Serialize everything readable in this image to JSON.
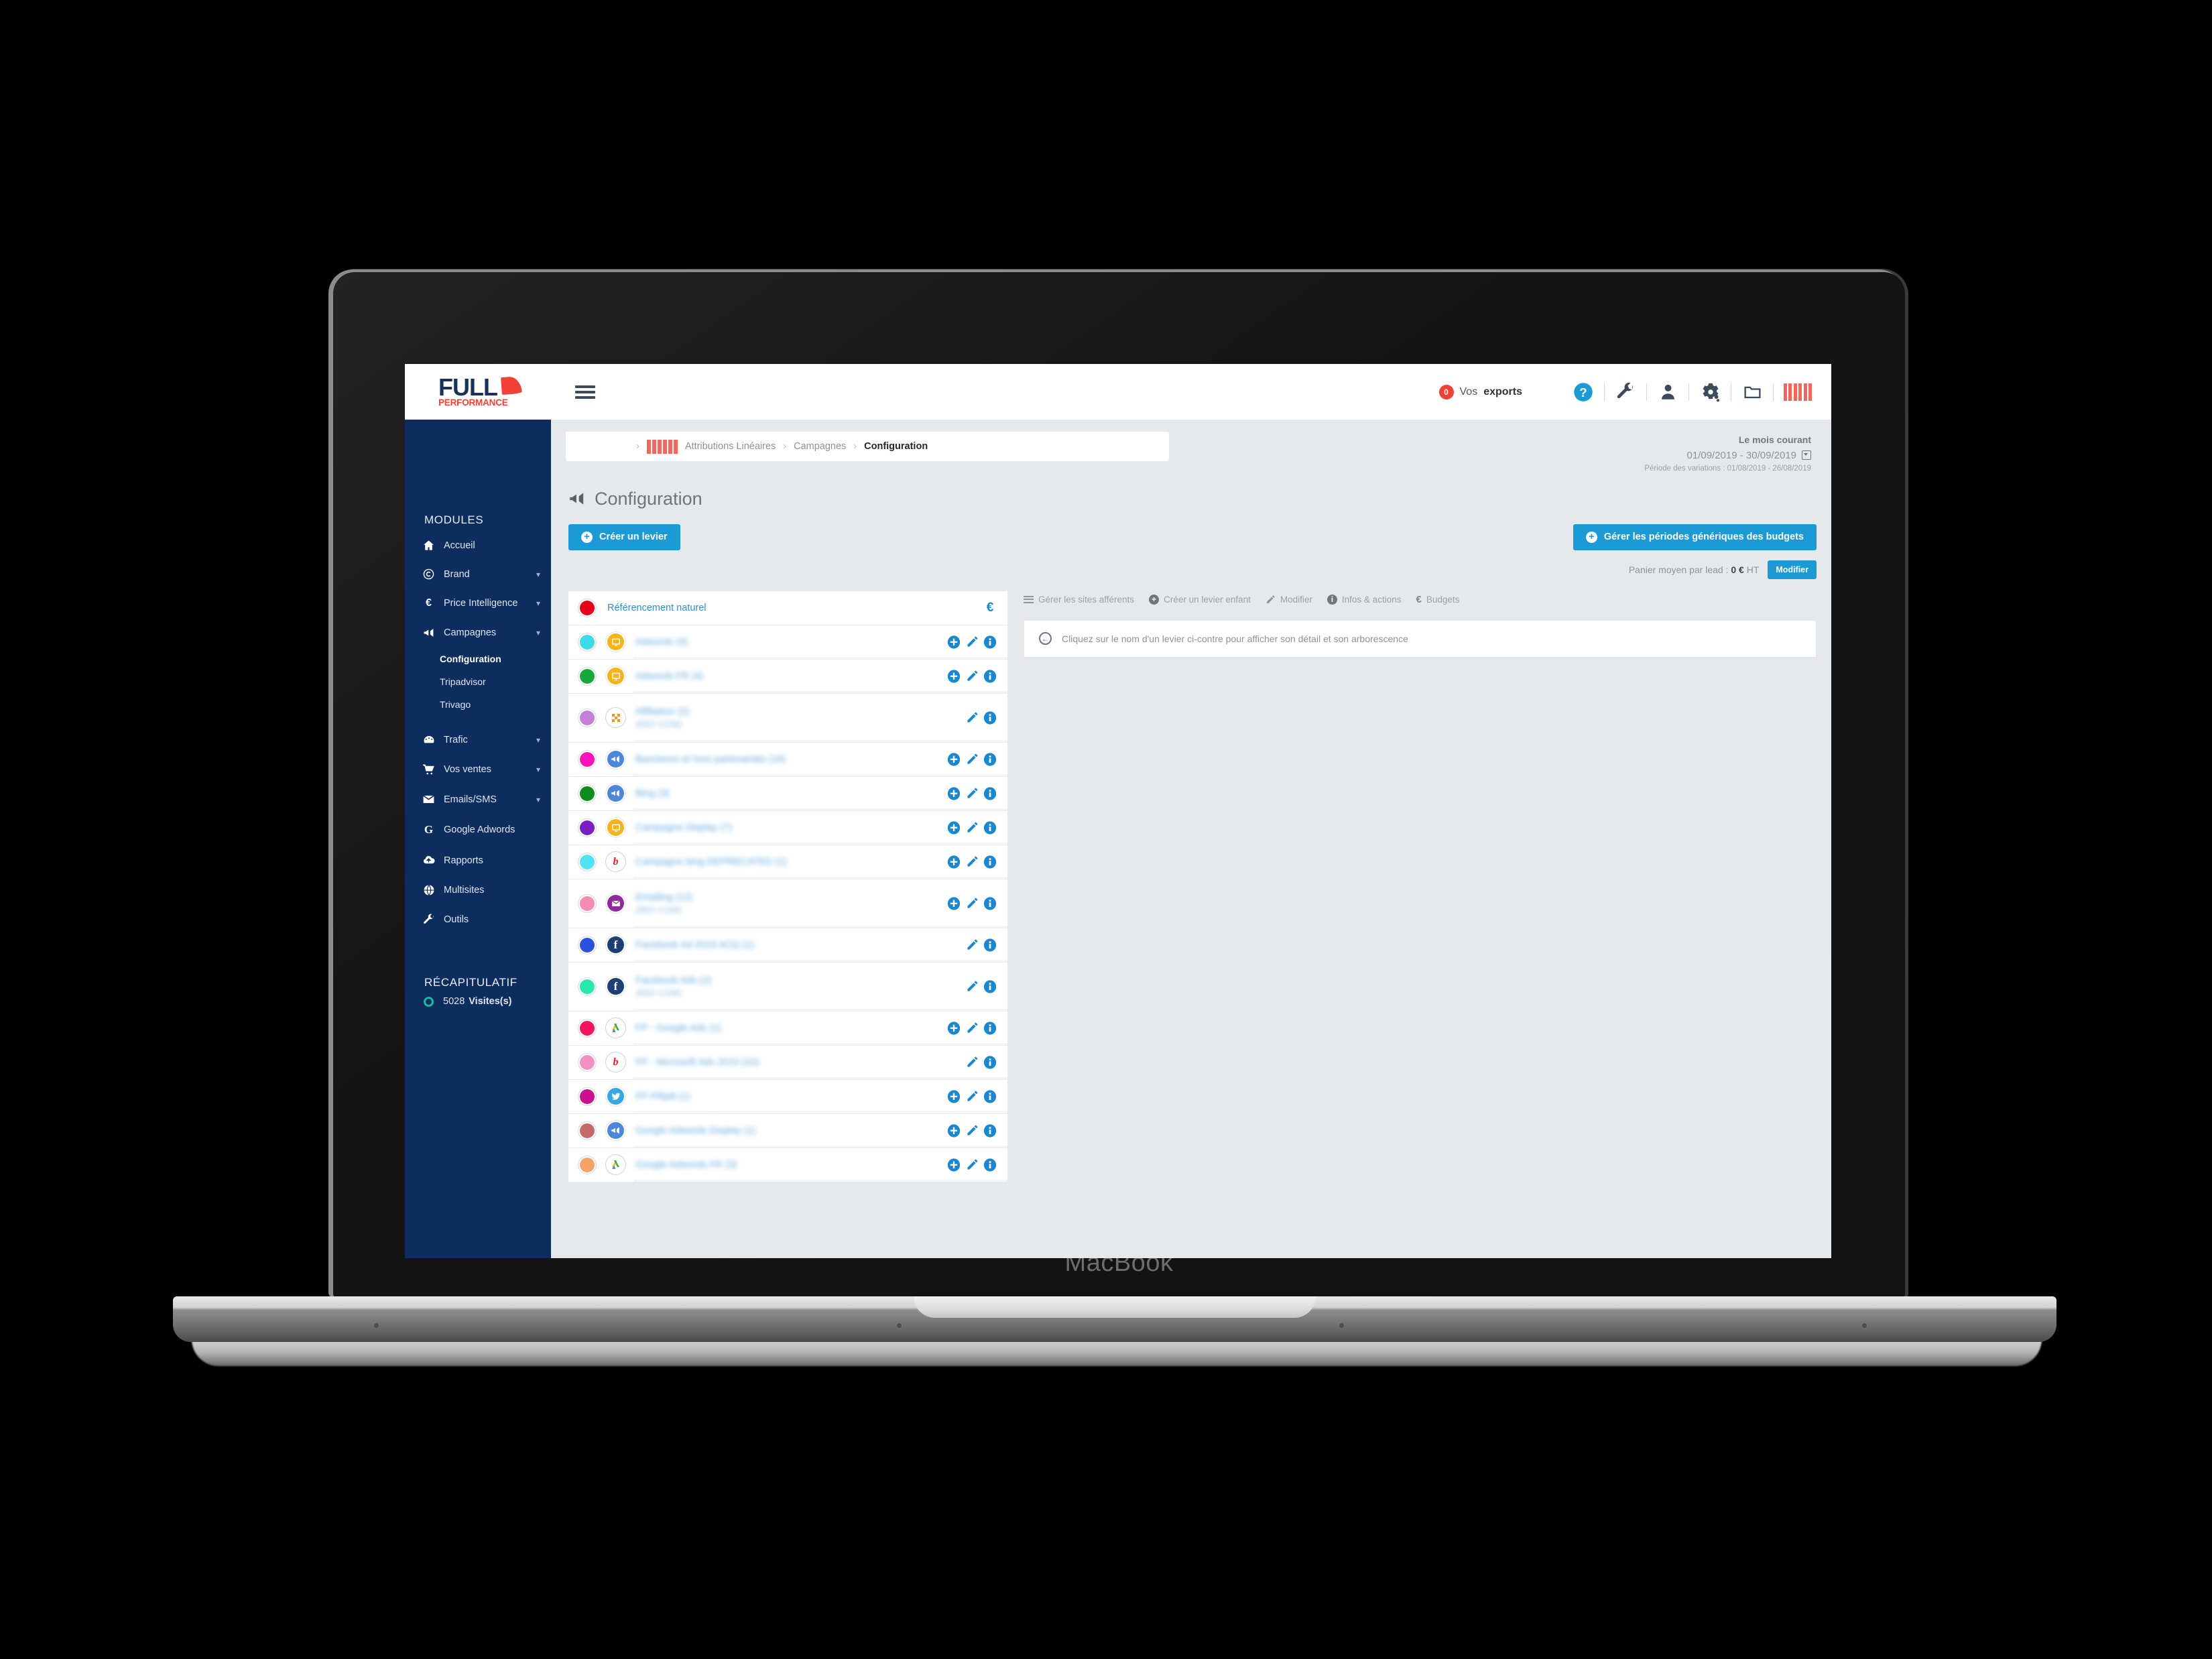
{
  "device": {
    "wordmark": "MacBook"
  },
  "topbar": {
    "logo": {
      "line1": "FULL",
      "line2": "PERFORMANCE",
      "swoosh_icon": "swoosh-icon"
    },
    "menu_toggle_icon": "hamburger-icon",
    "exports": {
      "count": "0",
      "label_prefix": "Vos ",
      "label_strong": "exports"
    },
    "icons": [
      {
        "name": "help-icon",
        "glyph": "?"
      },
      {
        "name": "wrench-icon",
        "glyph": "\u0000"
      },
      {
        "name": "user-icon",
        "glyph": "\u0000"
      },
      {
        "name": "settings-gears-icon",
        "glyph": "\u0000"
      },
      {
        "name": "folder-icon",
        "glyph": "\u0000"
      },
      {
        "name": "barcode-account-icon",
        "glyph": "\u0000"
      }
    ]
  },
  "sidebar": {
    "modules_heading": "MODULES",
    "items": [
      {
        "label": "Accueil",
        "icon": "home-icon",
        "expandable": false
      },
      {
        "label": "Brand",
        "icon": "copyright-icon",
        "expandable": true
      },
      {
        "label": "Price Intelligence",
        "icon": "euro-icon",
        "expandable": true
      },
      {
        "label": "Campagnes",
        "icon": "megaphone-icon",
        "expandable": true
      }
    ],
    "subitems": [
      {
        "label": "Configuration",
        "active": true
      },
      {
        "label": "Tripadvisor",
        "active": false
      },
      {
        "label": "Trivago",
        "active": false
      }
    ],
    "items2": [
      {
        "label": "Trafic",
        "icon": "gauge-icon",
        "expandable": true
      },
      {
        "label": "Vos ventes",
        "icon": "cart-icon",
        "expandable": true
      },
      {
        "label": "Emails/SMS",
        "icon": "envelope-icon",
        "expandable": true
      },
      {
        "label": "Google Adwords",
        "icon": "google-g-icon",
        "expandable": false
      },
      {
        "label": "Rapports",
        "icon": "cloud-upload-icon",
        "expandable": false
      },
      {
        "label": "Multisites",
        "icon": "globe-icon",
        "expandable": false
      },
      {
        "label": "Outils",
        "icon": "wrench-icon",
        "expandable": false
      }
    ],
    "recap_heading": "RÉCAPITULATIF",
    "recap": {
      "value": "5028",
      "unit": "Visites(s)",
      "icon": "ring-icon"
    }
  },
  "breadcrumb": {
    "chevron": "›",
    "account_icon": "barcode-account-icon",
    "items": [
      "Attributions Linéaires",
      "Campagnes",
      "Configuration"
    ],
    "separator": "›"
  },
  "daterange": {
    "title": "Le mois courant",
    "range": "01/09/2019 - 30/09/2019",
    "variations": "Période des variations : 01/08/2019 - 26/08/2019",
    "calendar_icon": "calendar-dropdown-icon"
  },
  "page": {
    "title": "Configuration",
    "title_icon": "megaphone-icon"
  },
  "actions": {
    "create_lever": "Créer un levier",
    "manage_budget_periods": "Gérer les périodes génériques des budgets",
    "avg_basket_label": "Panier moyen par lead : ",
    "avg_basket_value": "0 €",
    "avg_basket_suffix": " HT",
    "modify": "Modifier"
  },
  "right_toolbar": [
    {
      "label": "Gérer les sites afférents",
      "icon": "list-icon"
    },
    {
      "label": "Créer un levier enfant",
      "icon": "plus-circle-icon"
    },
    {
      "label": "Modifier",
      "icon": "pencil-icon"
    },
    {
      "label": "Infos & actions",
      "icon": "info-circle-icon"
    },
    {
      "label": "Budgets",
      "icon": "euro-icon"
    }
  ],
  "hint": {
    "icon": "back-arrow-circle-icon",
    "text": "Cliquez sur le nom d'un levier ci-contre pour afficher son détail et son arborescence"
  },
  "levers": [
    {
      "name": "Référencement naturel",
      "sub": "",
      "blurred": false,
      "dot": "#e4021b",
      "channel": null,
      "channel_icon": "",
      "channel_bg": "",
      "actions": [
        "euro"
      ]
    },
    {
      "name": "Adwords (4)",
      "sub": "",
      "blurred": true,
      "dot": "#3adbe8",
      "channel": "display-icon",
      "channel_icon": "▣",
      "channel_bg": "#f5b51a",
      "actions": [
        "plus",
        "pencil",
        "info"
      ]
    },
    {
      "name": "Adwords FR (4)",
      "sub": "",
      "blurred": true,
      "dot": "#17a83c",
      "channel": "display-icon",
      "channel_icon": "▣",
      "channel_bg": "#f5b51a",
      "actions": [
        "plus",
        "pencil",
        "info"
      ]
    },
    {
      "name": "Affiliation (2)",
      "sub": "(REF-COM)",
      "blurred": true,
      "dot": "#c580da",
      "channel": "affiliation-icon",
      "channel_icon": "❖",
      "channel_bg": "#ffffff",
      "actions": [
        "pencil",
        "info"
      ]
    },
    {
      "name": "Bannieres et hors partenariats (16)",
      "sub": "",
      "blurred": true,
      "dot": "#fa12b8",
      "channel": "megaphone-icon",
      "channel_icon": "⌗",
      "channel_bg": "#4d87d8",
      "actions": [
        "plus",
        "pencil",
        "info"
      ]
    },
    {
      "name": "Bing (3)",
      "sub": "",
      "blurred": true,
      "dot": "#0e8c1d",
      "channel": "megaphone-icon",
      "channel_icon": "⌗",
      "channel_bg": "#4d87d8",
      "actions": [
        "plus",
        "pencil",
        "info"
      ]
    },
    {
      "name": "Campagne Display (7)",
      "sub": "",
      "blurred": true,
      "dot": "#7a1fc4",
      "channel": "display-icon",
      "channel_icon": "▣",
      "channel_bg": "#f5b51a",
      "actions": [
        "plus",
        "pencil",
        "info"
      ]
    },
    {
      "name": "Campagne bing DEPRECATED (1)",
      "sub": "",
      "blurred": true,
      "dot": "#4fe3f2",
      "channel": "bing-icon",
      "channel_icon": "b",
      "channel_bg": "#ffffff",
      "actions": [
        "plus",
        "pencil",
        "info"
      ]
    },
    {
      "name": "Emailing (12)",
      "sub": "(REF-COM)",
      "blurred": true,
      "dot": "#f58bb4",
      "channel": "email-icon",
      "channel_icon": "✉",
      "channel_bg": "#8e2a9e",
      "actions": [
        "plus",
        "pencil",
        "info"
      ]
    },
    {
      "name": "Facebook Ad 2019 ACQ (1)",
      "sub": "",
      "blurred": true,
      "dot": "#2a52dc",
      "channel": "facebook-icon",
      "channel_icon": "f",
      "channel_bg": "#1d3f73",
      "actions": [
        "pencil",
        "info"
      ]
    },
    {
      "name": "Facebook Ads (2)",
      "sub": "(REF-COM)",
      "blurred": true,
      "dot": "#2ae8ab",
      "channel": "facebook-icon",
      "channel_icon": "f",
      "channel_bg": "#1d3f73",
      "actions": [
        "pencil",
        "info"
      ]
    },
    {
      "name": "FP - Google Ads (1)",
      "sub": "",
      "blurred": true,
      "dot": "#f5155e",
      "channel": "google-ads-icon",
      "channel_icon": "A",
      "channel_bg": "#ffffff",
      "actions": [
        "plus",
        "pencil",
        "info"
      ]
    },
    {
      "name": "FP - Microsoft Ads 2019 (10)",
      "sub": "",
      "blurred": true,
      "dot": "#f48fc2",
      "channel": "bing-icon",
      "channel_icon": "b",
      "channel_bg": "#ffffff",
      "actions": [
        "pencil",
        "info"
      ]
    },
    {
      "name": "FP-Pilipili (1)",
      "sub": "",
      "blurred": true,
      "dot": "#cc0f90",
      "channel": "twitter-icon",
      "channel_icon": "✈",
      "channel_bg": "#35a8e0",
      "actions": [
        "plus",
        "pencil",
        "info"
      ]
    },
    {
      "name": "Google Adwords Display (1)",
      "sub": "",
      "blurred": true,
      "dot": "#c46a6a",
      "channel": "megaphone-icon",
      "channel_icon": "⌗",
      "channel_bg": "#4d87d8",
      "actions": [
        "plus",
        "pencil",
        "info"
      ]
    },
    {
      "name": "Google Adwords FR (3)",
      "sub": "",
      "blurred": true,
      "dot": "#f5a468",
      "channel": "google-ads-icon",
      "channel_icon": "A",
      "channel_bg": "#ffffff",
      "actions": [
        "plus",
        "pencil",
        "info"
      ]
    }
  ],
  "colors": {
    "brand_navy": "#0d2d5e",
    "brand_red": "#ef4136",
    "accent_blue": "#1b9ad6",
    "link_blue": "#2e8fd4",
    "page_bg": "#e6e9ec"
  }
}
